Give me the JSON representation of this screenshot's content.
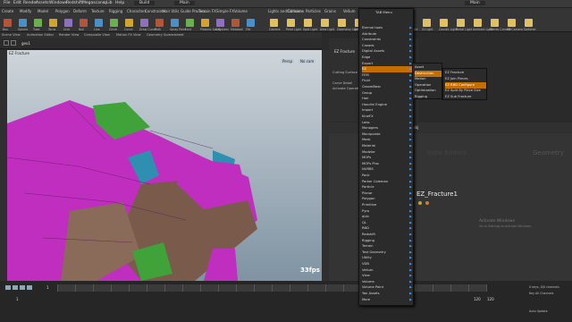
{
  "menubar": {
    "items": [
      "File",
      "Edit",
      "Render",
      "Assets",
      "Windows",
      "Redshift",
      "Megascans",
      "qLib",
      "Help"
    ],
    "build": "Build",
    "desktop": "Main"
  },
  "shelf": {
    "tabs": [
      "Create",
      "Modify",
      "Model",
      "Polygon",
      "Deform",
      "Texture",
      "Rigging",
      "Characters",
      "Constraints",
      "Hair Utils",
      "Guide Process",
      "Terrain FX",
      "Simple FX",
      "Volume"
    ],
    "tools": [
      "Box",
      "Sphere",
      "Tube",
      "Torus",
      "Grid",
      "Null",
      "Line",
      "Circle",
      "Curve",
      "Draw Curve",
      "Path",
      "Spray Paint",
      "Font",
      "Platonic Solids",
      "L-System",
      "Metaball",
      "File"
    ],
    "right_tabs": [
      "Lights and Cameras",
      "Collisions",
      "Particles",
      "Grains",
      "Vellum",
      "Rigid Bodies",
      "Particle Fluids"
    ],
    "right_tools": [
      "Camera",
      "Point Light",
      "Spot Light",
      "Area Light",
      "Geometry Light",
      "Volume Light",
      "Distant Light",
      "Environment Light",
      "Sky Light",
      "GI Light",
      "Caustic Light",
      "Portal Light",
      "Ambient Light",
      "Stereo Camera",
      "VR Camera",
      "Switcher"
    ]
  },
  "left_tabs": [
    "Scene View",
    "Animation Editor",
    "Render View",
    "Composite View",
    "Motion FX View",
    "Geometry Spreadsheet"
  ],
  "viewport": {
    "path": "geo1",
    "title": "EZ Fracture",
    "persp": "Persp",
    "cam": "No cam",
    "fps": "33fps",
    "colors": {
      "sky_top": "#cfd5da",
      "sky_bottom": "#7f93a2",
      "magenta": "#c02ec0",
      "brown": "#7a5a4a",
      "green": "#3fa33a",
      "teal": "#2f8fb0"
    }
  },
  "params": {
    "title": "EZ Fracture",
    "label_cutting": "Cutting Surface",
    "label_carve": "Carve Detail",
    "label_activate": "Activate Operation",
    "stop": "Stop"
  },
  "network": {
    "path": "obj",
    "tabs": [
      "/obj/geo1",
      "Tree View",
      "Material Palette",
      "Asset Browser"
    ],
    "node_name": "EZ_Fracture1",
    "watermark_left": "Indie Edition",
    "watermark_right": "Geometry",
    "menu_items": [
      "Add",
      "Edit",
      "Go",
      "View",
      "Tools",
      "Layout",
      "Help"
    ]
  },
  "tab_menu": {
    "title": "TAB Menu",
    "items": [
      {
        "label": "Eternal tools",
        "sub": true
      },
      {
        "label": "Attribute",
        "sub": true
      },
      {
        "label": "Constraints",
        "sub": true
      },
      {
        "label": "Crowds",
        "sub": true
      },
      {
        "label": "Digital Assets",
        "sub": true
      },
      {
        "label": "Edge",
        "sub": true
      },
      {
        "label": "Export",
        "sub": true
      },
      {
        "label": "EZ",
        "sub": true,
        "selected": true
      },
      {
        "label": "FEM",
        "sub": true
      },
      {
        "label": "Fluid",
        "sub": true
      },
      {
        "label": "GroomBear",
        "sub": true
      },
      {
        "label": "Group",
        "sub": true
      },
      {
        "label": "Hair",
        "sub": true
      },
      {
        "label": "Houdini Engine",
        "sub": true
      },
      {
        "label": "Import",
        "sub": true
      },
      {
        "label": "KineFX",
        "sub": true
      },
      {
        "label": "Labs",
        "sub": true
      },
      {
        "label": "Managers",
        "sub": true
      },
      {
        "label": "Manipulate",
        "sub": true
      },
      {
        "label": "Mask",
        "sub": true
      },
      {
        "label": "Material",
        "sub": true
      },
      {
        "label": "Modeler",
        "sub": true
      },
      {
        "label": "MOPs",
        "sub": true
      },
      {
        "label": "MOPs Plus",
        "sub": true
      },
      {
        "label": "NURBS",
        "sub": true
      },
      {
        "label": "Pack",
        "sub": true
      },
      {
        "label": "Parker Coleman",
        "sub": true
      },
      {
        "label": "Particle",
        "sub": true
      },
      {
        "label": "Planar",
        "sub": true
      },
      {
        "label": "Polygon",
        "sub": true
      },
      {
        "label": "Primitive",
        "sub": true
      },
      {
        "label": "Pyro",
        "sub": true
      },
      {
        "label": "qLib",
        "sub": true
      },
      {
        "label": "QL",
        "sub": true
      },
      {
        "label": "RBD",
        "sub": true
      },
      {
        "label": "Redshift",
        "sub": true
      },
      {
        "label": "Rigging",
        "sub": true
      },
      {
        "label": "Terrain",
        "sub": true
      },
      {
        "label": "Test Geometry",
        "sub": true
      },
      {
        "label": "Utility",
        "sub": true
      },
      {
        "label": "VDB",
        "sub": true
      },
      {
        "label": "Vellum",
        "sub": true
      },
      {
        "label": "View",
        "sub": true
      },
      {
        "label": "Volume",
        "sub": true
      },
      {
        "label": "Volume Paint",
        "sub": true
      },
      {
        "label": "Yan Assets",
        "sub": true
      },
      {
        "label": "More",
        "sub": true
      }
    ]
  },
  "submenu_ez": {
    "items": [
      {
        "label": "Asset"
      },
      {
        "label": "Destruction",
        "selected": true
      },
      {
        "label": "Motion"
      },
      {
        "label": "Operation"
      },
      {
        "label": "Optimization"
      },
      {
        "label": "Rigging"
      }
    ]
  },
  "submenu_destruction": {
    "items": [
      {
        "label": "EZ Fracture"
      },
      {
        "label": "EZ Join Pieces"
      },
      {
        "label": "EZ RBD Configure",
        "selected": true
      },
      {
        "label": "EZ Split By Piece Size"
      },
      {
        "label": "EZ Sub Fracture"
      }
    ]
  },
  "timeline": {
    "frame": "1",
    "start": "1",
    "end": "120",
    "end2": "120",
    "windows_activate": "Activate Windows",
    "windows_hint": "Go to Settings to activate Windows.",
    "keys_info": "0 keys, 0/0 channels",
    "keys_all": "Key All Channels",
    "auto_update": "Auto Update"
  }
}
